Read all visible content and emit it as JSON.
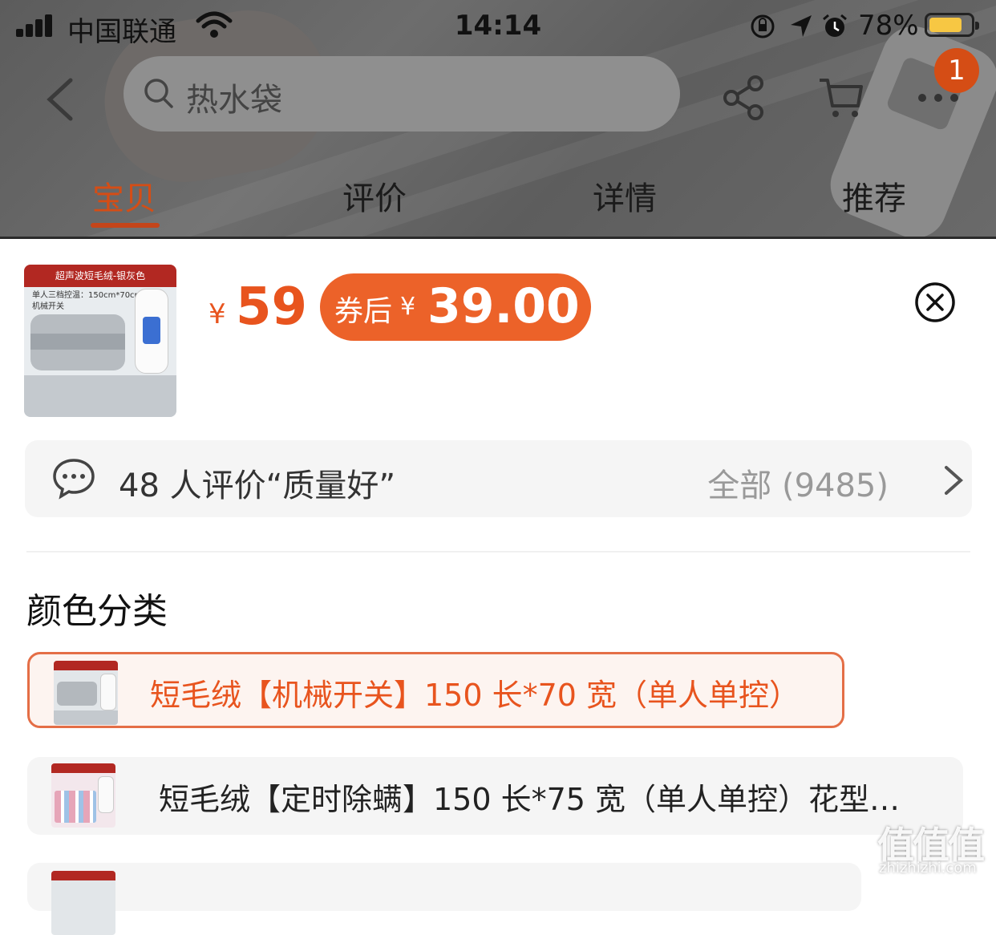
{
  "status_bar": {
    "carrier": "中国联通",
    "time": "14:14",
    "battery_percent": "78%",
    "battery_level": 0.78,
    "icons": [
      "signal-icon",
      "wifi-icon",
      "orientation-lock-icon",
      "location-arrow-icon",
      "alarm-icon",
      "battery-icon"
    ]
  },
  "nav": {
    "search_placeholder": "热水袋",
    "cart_badge": "1",
    "icons": [
      "back-arrow-icon",
      "search-icon",
      "share-icon",
      "cart-icon",
      "more-icon"
    ]
  },
  "tabs": [
    {
      "label": "宝贝",
      "active": true
    },
    {
      "label": "评价",
      "active": false
    },
    {
      "label": "详情",
      "active": false
    },
    {
      "label": "推荐",
      "active": false
    }
  ],
  "product": {
    "thumb_banner": "超声波短毛绒-银灰色",
    "thumb_caption_1": "单人三档控温：150cm*70cm",
    "thumb_caption_2": "机械开关",
    "yen_symbol": "¥",
    "price": "59",
    "coupon_label": "券后",
    "coupon_yen": "¥",
    "coupon_price": "39.00"
  },
  "review_bar": {
    "text": "48 人评价“质量好”",
    "all_label": "全部 (9485)"
  },
  "section_title": "颜色分类",
  "options": [
    {
      "label": "短毛绒【机械开关】150 长*70 宽（单人单控）",
      "selected": true
    },
    {
      "label": "短毛绒【定时除螨】150 长*75 宽（单人单控）花型…",
      "selected": false
    }
  ],
  "watermark": {
    "big": "值值值",
    "small": "zhizhizhi.com"
  },
  "colors": {
    "accent": "#e8541e",
    "badge": "#d54d15",
    "coupon_bg": "#ec6229",
    "selected_border": "#e46e46"
  }
}
